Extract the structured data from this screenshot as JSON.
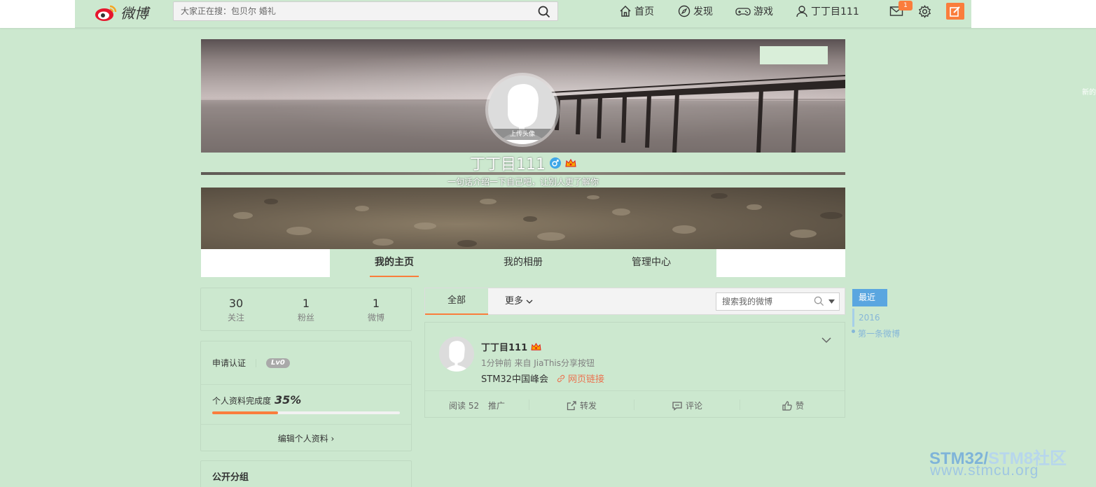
{
  "topbar": {
    "logo_text": "微博",
    "search_placeholder": "大家正在搜：包贝尔 婚礼",
    "nav": {
      "home": "首页",
      "discover": "发现",
      "game": "游戏",
      "user": "丁丁目111"
    },
    "message_count": "1"
  },
  "profile": {
    "upload_avatar": "上传头像",
    "name": "丁丁目111",
    "intro": "一句话介绍一下自己吧，让别人更了解你",
    "tabs": [
      "我的主页",
      "我的相册",
      "管理中心"
    ]
  },
  "stats": [
    {
      "value": "30",
      "label": "关注"
    },
    {
      "value": "1",
      "label": "粉丝"
    },
    {
      "value": "1",
      "label": "微博"
    }
  ],
  "verify": {
    "label": "申请认证",
    "level": "Lv0",
    "completion_label": "个人资料完成度",
    "completion_value": "35%",
    "completion_fraction": 0.35,
    "edit_label": "编辑个人资料 ›"
  },
  "groups": {
    "title": "公开分组"
  },
  "feed": {
    "tab_all": "全部",
    "tab_more": "更多",
    "search_placeholder": "搜索我的微博",
    "post": {
      "author": "丁丁目111",
      "meta": "1分钟前 来自 JiaThis分享按钮",
      "text": "STM32中国峰会",
      "link_text": "网页链接",
      "reads": "阅读 52",
      "promote": "推广",
      "repost": "转发",
      "comment": "评论",
      "like": "赞"
    }
  },
  "timeline": {
    "recent": "最近",
    "year": "2016",
    "first": "第一条微博"
  },
  "edge_text": "新的",
  "watermark": {
    "line1_a": "STM32/",
    "line1_b": "STM8社区",
    "line2": "www.stmcu.org"
  },
  "colors": {
    "accent": "#fa7d3c",
    "background": "#cce8cf",
    "timeline_blue": "#5aa6e0"
  }
}
